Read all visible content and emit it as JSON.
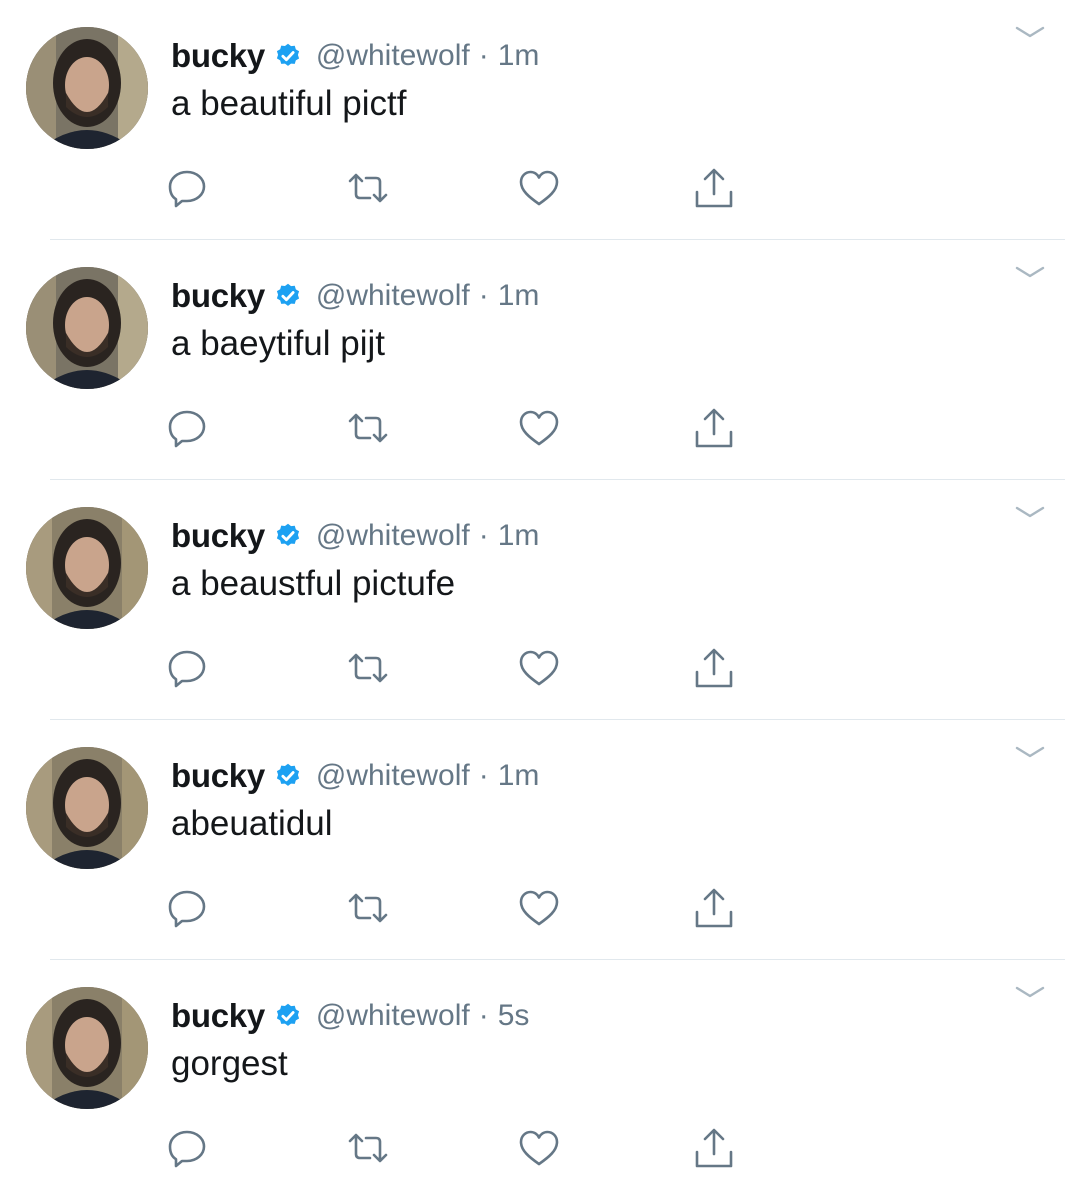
{
  "accent_color": "#1da1f2",
  "icon_color": "#657786",
  "tweets": [
    {
      "name": "bucky",
      "handle": "@whitewolf",
      "separator": "·",
      "time": "1m",
      "text": "a beautiful pictf"
    },
    {
      "name": "bucky",
      "handle": "@whitewolf",
      "separator": "·",
      "time": "1m",
      "text": "a baeytiful pijt"
    },
    {
      "name": "bucky",
      "handle": "@whitewolf",
      "separator": "·",
      "time": "1m",
      "text": "a beaustful pictufe"
    },
    {
      "name": "bucky",
      "handle": "@whitewolf",
      "separator": "·",
      "time": "1m",
      "text": "abeuatidul"
    },
    {
      "name": "bucky",
      "handle": "@whitewolf",
      "separator": "·",
      "time": "5s",
      "text": "gorgest"
    }
  ],
  "icons": {
    "verified": "verified-badge-icon",
    "caret": "chevron-down-icon",
    "reply": "reply-icon",
    "retweet": "retweet-icon",
    "like": "heart-icon",
    "share": "share-icon"
  }
}
